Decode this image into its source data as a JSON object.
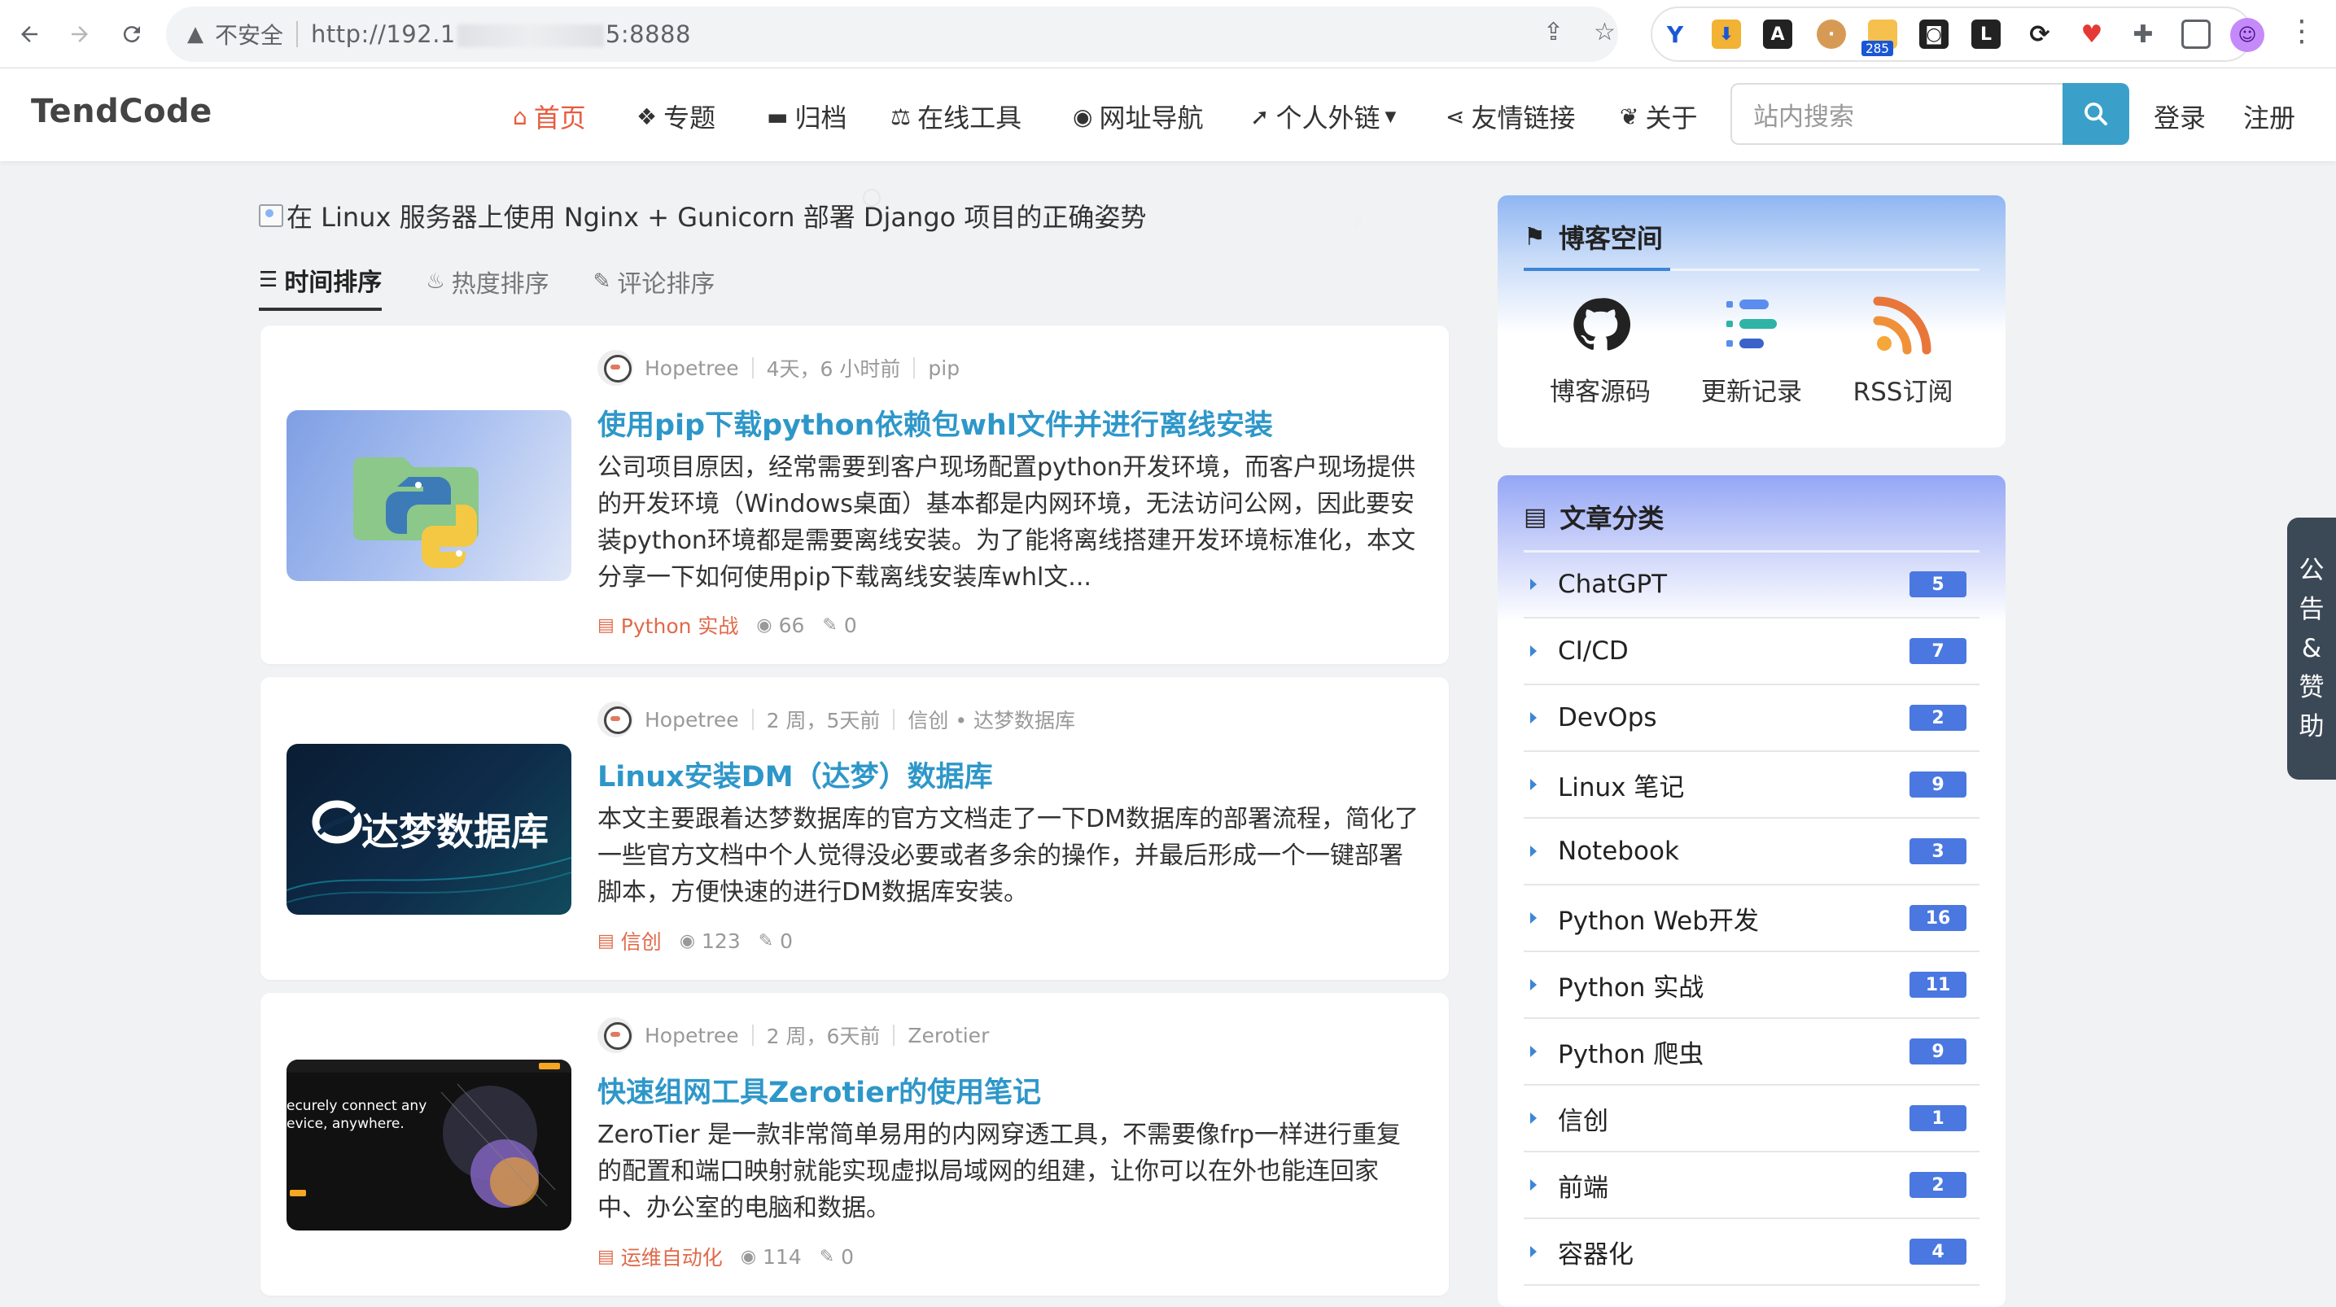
{
  "browser": {
    "security_label": "不安全",
    "url_prefix": "http://192.1",
    "url_suffix": "5:8888",
    "extension_badge": "285"
  },
  "site": {
    "brand": "TendCode",
    "menu": [
      {
        "label": "首页",
        "icon": "home-icon",
        "active": true
      },
      {
        "label": "专题",
        "icon": "cubes-icon"
      },
      {
        "label": "归档",
        "icon": "archive-icon"
      },
      {
        "label": "在线工具",
        "icon": "balance-scale-icon"
      },
      {
        "label": "网址导航",
        "icon": "compass-icon"
      },
      {
        "label": "个人外链",
        "icon": "paper-plane-icon"
      },
      {
        "label": "友情链接",
        "icon": "share-alt-icon"
      },
      {
        "label": "关于",
        "icon": "leaf-icon"
      }
    ],
    "search_placeholder": "站内搜索",
    "login": "登录",
    "register": "注册"
  },
  "banner": {
    "alt": "在 Linux 服务器上使用 Nginx + Gunicorn 部署 Django 项目的正确姿势"
  },
  "sort_tabs": [
    {
      "label": "时间排序",
      "icon": "bars-icon",
      "active": true
    },
    {
      "label": "热度排序",
      "icon": "fire-icon"
    },
    {
      "label": "评论排序",
      "icon": "comments-icon"
    }
  ],
  "articles": [
    {
      "author": "Hopetree",
      "time": "4天，6 小时前",
      "tags": "pip",
      "title": "使用pip下载python依赖包whl文件并进行离线安装",
      "excerpt": "公司项目原因，经常需要到客户现场配置python开发环境，而客户现场提供的开发环境（Windows桌面）基本都是内网环境，无法访问公网，因此要安装python环境都是需要离线安装。为了能将离线搭建开发环境标准化，本文分享一下如何使用pip下载离线安装库whl文...",
      "category": "Python 实战",
      "views": "66",
      "comments": "0"
    },
    {
      "author": "Hopetree",
      "time": "2 周，5天前",
      "tags": "信创 • 达梦数据库",
      "title": "Linux安装DM（达梦）数据库",
      "excerpt": "本文主要跟着达梦数据库的官方文档走了一下DM数据库的部署流程，简化了一些官方文档中个人觉得没必要或者多余的操作，并最后形成一个一键部署脚本，方便快速的进行DM数据库安装。",
      "category": "信创",
      "views": "123",
      "comments": "0",
      "thumb_text": "达梦数据库"
    },
    {
      "author": "Hopetree",
      "time": "2 周，6天前",
      "tags": "Zerotier",
      "title": "快速组网工具Zerotier的使用笔记",
      "excerpt": "ZeroTier 是一款非常简单易用的内网穿透工具，不需要像frp一样进行重复的配置和端口映射就能实现虚拟局域网的组建，让你可以在外也能连回家中、办公室的电脑和数据。",
      "category": "运维自动化",
      "views": "114",
      "comments": "0",
      "thumb_text": "ecurely connect any\nevice, anywhere."
    }
  ],
  "sidebar": {
    "blog_space": {
      "title": "博客空间",
      "links": [
        {
          "label": "博客源码",
          "icon": "github-icon"
        },
        {
          "label": "更新记录",
          "icon": "timeline-icon"
        },
        {
          "label": "RSS订阅",
          "icon": "rss-icon"
        }
      ]
    },
    "categories": {
      "title": "文章分类",
      "items": [
        {
          "name": "ChatGPT",
          "count": "5"
        },
        {
          "name": "CI/CD",
          "count": "7"
        },
        {
          "name": "DevOps",
          "count": "2"
        },
        {
          "name": "Linux 笔记",
          "count": "9"
        },
        {
          "name": "Notebook",
          "count": "3"
        },
        {
          "name": "Python Web开发",
          "count": "16"
        },
        {
          "name": "Python 实战",
          "count": "11"
        },
        {
          "name": "Python 爬虫",
          "count": "9"
        },
        {
          "name": "信创",
          "count": "1"
        },
        {
          "name": "前端",
          "count": "2"
        },
        {
          "name": "容器化",
          "count": "4"
        }
      ]
    },
    "side_tab": [
      "公",
      "告",
      "&",
      "赞",
      "助"
    ]
  },
  "colors": {
    "accent": "#2e97c9",
    "active_menu": "#e85b3f",
    "category_badge": "#4a78e0",
    "search_button": "#3aa0c9"
  }
}
